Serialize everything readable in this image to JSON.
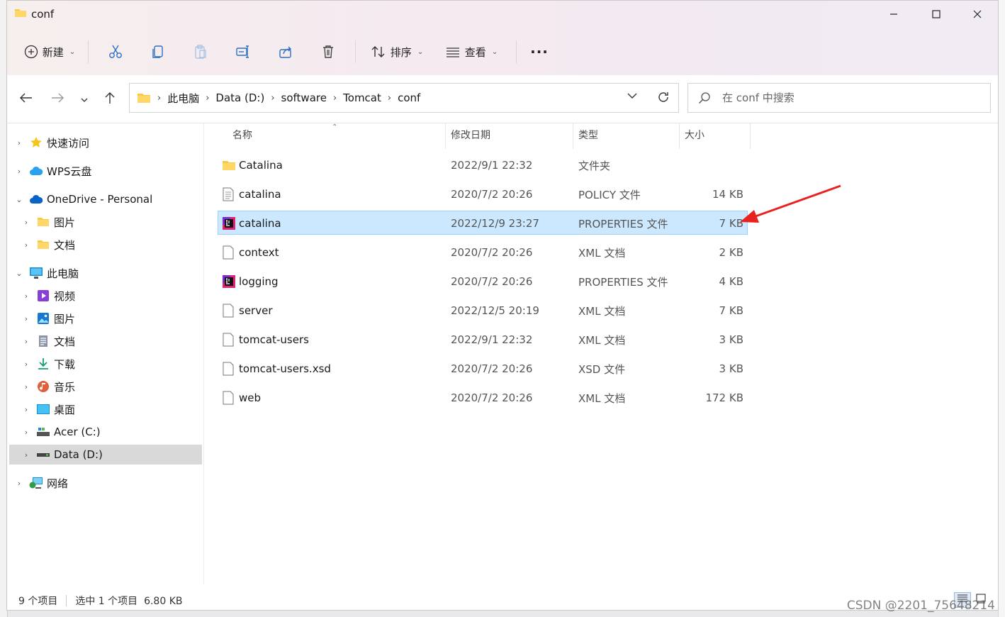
{
  "window": {
    "title": "conf",
    "controls": [
      "minimize",
      "maximize",
      "close"
    ]
  },
  "toolbar": {
    "new_label": "新建",
    "sort_label": "排序",
    "view_label": "查看",
    "more_label": "···",
    "icons": [
      "cut-icon",
      "copy-icon",
      "paste-icon",
      "rename-icon",
      "share-icon",
      "delete-icon"
    ]
  },
  "address": {
    "root_label": "此电脑",
    "crumbs": [
      "Data (D:)",
      "software",
      "Tomcat",
      "conf"
    ]
  },
  "search": {
    "placeholder": "在 conf 中搜索"
  },
  "sidebar": {
    "items": [
      {
        "label": "快速访问",
        "icon": "star-icon"
      },
      {
        "label": "WPS云盘",
        "icon": "cloud-icon"
      },
      {
        "label": "OneDrive - Personal",
        "icon": "onedrive-icon"
      },
      {
        "label": "图片",
        "icon": "folder-icon"
      },
      {
        "label": "文档",
        "icon": "folder-icon"
      },
      {
        "label": "此电脑",
        "icon": "pc-icon"
      },
      {
        "label": "视频",
        "icon": "video-icon"
      },
      {
        "label": "图片",
        "icon": "pictures-icon"
      },
      {
        "label": "文档",
        "icon": "documents-icon"
      },
      {
        "label": "下载",
        "icon": "download-icon"
      },
      {
        "label": "音乐",
        "icon": "music-icon"
      },
      {
        "label": "桌面",
        "icon": "desktop-icon"
      },
      {
        "label": "Acer (C:)",
        "icon": "drive-c-icon"
      },
      {
        "label": "Data (D:)",
        "icon": "drive-d-icon"
      },
      {
        "label": "网络",
        "icon": "network-icon"
      }
    ]
  },
  "columns": {
    "name": "名称",
    "modified": "修改日期",
    "type": "类型",
    "size": "大小"
  },
  "files": [
    {
      "name": "Catalina",
      "modified": "2022/9/1 22:32",
      "type": "文件夹",
      "size": "",
      "icon": "folder-icon"
    },
    {
      "name": "catalina",
      "modified": "2020/7/2 20:26",
      "type": "POLICY 文件",
      "size": "14 KB",
      "icon": "file-text-icon"
    },
    {
      "name": "catalina",
      "modified": "2022/12/9 23:27",
      "type": "PROPERTIES 文件",
      "size": "7 KB",
      "icon": "intellij-icon"
    },
    {
      "name": "context",
      "modified": "2020/7/2 20:26",
      "type": "XML 文档",
      "size": "2 KB",
      "icon": "file-icon"
    },
    {
      "name": "logging",
      "modified": "2020/7/2 20:26",
      "type": "PROPERTIES 文件",
      "size": "4 KB",
      "icon": "intellij-icon"
    },
    {
      "name": "server",
      "modified": "2022/12/5 20:19",
      "type": "XML 文档",
      "size": "7 KB",
      "icon": "file-icon"
    },
    {
      "name": "tomcat-users",
      "modified": "2022/9/1 22:32",
      "type": "XML 文档",
      "size": "3 KB",
      "icon": "file-icon"
    },
    {
      "name": "tomcat-users.xsd",
      "modified": "2020/7/2 20:26",
      "type": "XSD 文件",
      "size": "3 KB",
      "icon": "file-icon"
    },
    {
      "name": "web",
      "modified": "2020/7/2 20:26",
      "type": "XML 文档",
      "size": "172 KB",
      "icon": "file-icon"
    }
  ],
  "status": {
    "count": "9 个项目",
    "selection": "选中 1 个项目  6.80 KB"
  },
  "watermark": "CSDN @2201_75648214",
  "colors": {
    "accent": "#0078d4",
    "selection": "#cce8ff",
    "annotation_arrow": "#e8231f"
  }
}
